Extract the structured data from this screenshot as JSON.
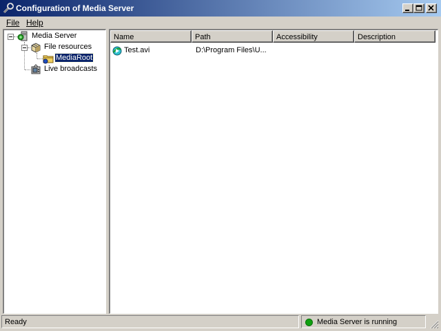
{
  "window": {
    "title": "Configuration of Media Server",
    "icon": "wrench-icon"
  },
  "menubar": {
    "items": [
      {
        "label": "File",
        "accel": "F"
      },
      {
        "label": "Help",
        "accel": "H"
      }
    ]
  },
  "tree": {
    "root": {
      "label": "Media Server",
      "icon": "server-icon"
    },
    "file_resources": {
      "label": "File resources",
      "icon": "cube-icon"
    },
    "media_root": {
      "label": "MediaRoot",
      "icon": "folder-icon",
      "selected": true
    },
    "live_broadcasts": {
      "label": "Live broadcasts",
      "icon": "broadcast-icon"
    }
  },
  "list": {
    "columns": [
      "Name",
      "Path",
      "Accessibility",
      "Description"
    ],
    "rows": [
      {
        "name": "Test.avi",
        "path": "D:\\Program Files\\U...",
        "accessibility": "",
        "description": "",
        "icon": "media-file-icon"
      }
    ]
  },
  "statusbar": {
    "ready": "Ready",
    "server_status": "Media Server is running",
    "server_status_color": "#10a010"
  },
  "colors": {
    "title_active_start": "#0a246a",
    "title_active_end": "#a6caf0",
    "face": "#d4d0c8",
    "selection": "#0a246a"
  }
}
